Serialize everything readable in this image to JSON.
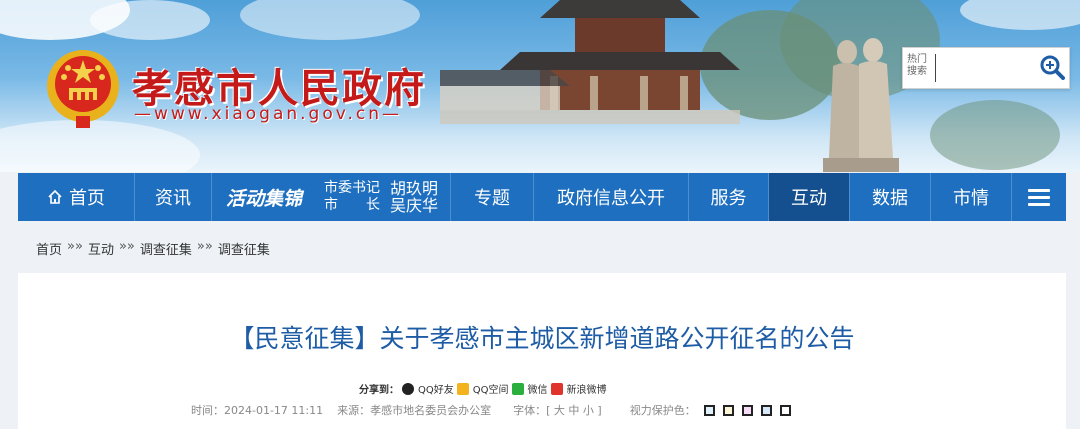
{
  "header": {
    "site_title": "孝感市人民政府",
    "site_domain": "—www.xiaogan.gov.cn—",
    "search": {
      "label": "热门搜索",
      "placeholder": "",
      "button_icon": "search-icon"
    }
  },
  "nav": {
    "home": "首页",
    "items": [
      "资讯",
      "活动集锦",
      "专题",
      "政府信息公开",
      "服务",
      "互动",
      "数据",
      "市情"
    ],
    "leaders": [
      {
        "role": "市委书记",
        "name": "胡玖明"
      },
      {
        "role": "市长",
        "name": "吴庆华"
      }
    ],
    "active": "互动",
    "menu_icon": "menu-icon"
  },
  "breadcrumb": [
    "首页",
    "互动",
    "调查征集",
    "调查征集"
  ],
  "breadcrumb_sep": "»»",
  "article": {
    "title": "【民意征集】关于孝感市主城区新增道路公开征名的公告",
    "share_label": "分享到：",
    "share_targets": [
      "QQ好友",
      "QQ空间",
      "微信",
      "新浪微博"
    ],
    "time": "时间：2024-01-17 11:11",
    "source": "来源：孝感市地名委员会办公室",
    "font_size": "字体：[ 大 中 小 ]",
    "eye_protect": "视力保护色：",
    "swatch_colors": [
      "#dff1fb",
      "#fbf6d8",
      "#f6dcf6",
      "#d7e8fa",
      "#ffffff"
    ]
  },
  "colors": {
    "nav_bg": "#1e6fbf",
    "nav_active": "#14508f",
    "title_red": "#c51a1a",
    "article_title": "#1e5ca5"
  }
}
